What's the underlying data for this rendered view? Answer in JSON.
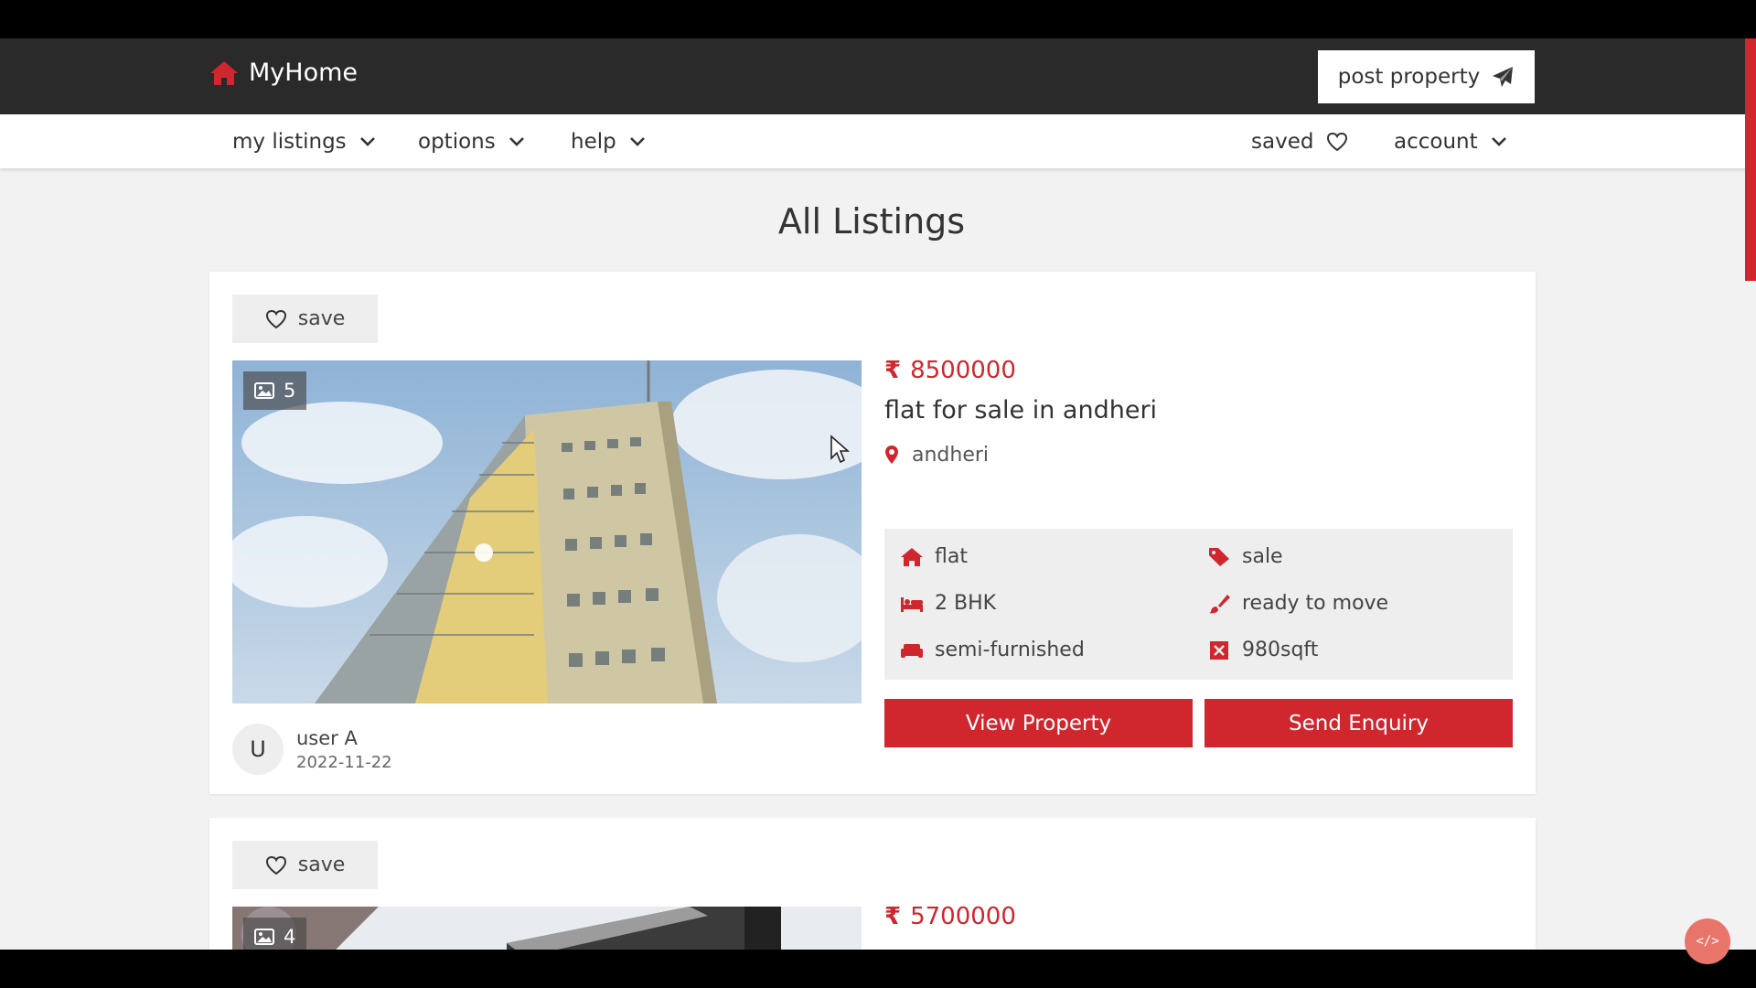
{
  "header": {
    "logo_text": "MyHome",
    "post_button_label": "post property"
  },
  "nav": {
    "left": [
      {
        "label": "my listings"
      },
      {
        "label": "options"
      },
      {
        "label": "help"
      }
    ],
    "saved_label": "saved",
    "account_label": "account"
  },
  "page": {
    "title": "All Listings"
  },
  "listings": [
    {
      "save_label": "save",
      "photo_count": "5",
      "currency_symbol": "₹",
      "price": "8500000",
      "title": "flat for sale in andheri",
      "location": "andheri",
      "features": {
        "type": "flat",
        "deal": "sale",
        "bhk": "2 BHK",
        "status": "ready to move",
        "furnishing": "semi-furnished",
        "area": "980sqft"
      },
      "view_label": "View Property",
      "enquiry_label": "Send Enquiry",
      "user_initial": "U",
      "user_name": "user A",
      "date": "2022-11-22"
    },
    {
      "save_label": "save",
      "photo_count": "4",
      "currency_symbol": "₹",
      "price": "5700000"
    }
  ],
  "colors": {
    "accent": "#d0262e",
    "header_bg": "#2a2a2a",
    "page_bg": "#f2f2f2"
  },
  "dev_badge": "</>"
}
